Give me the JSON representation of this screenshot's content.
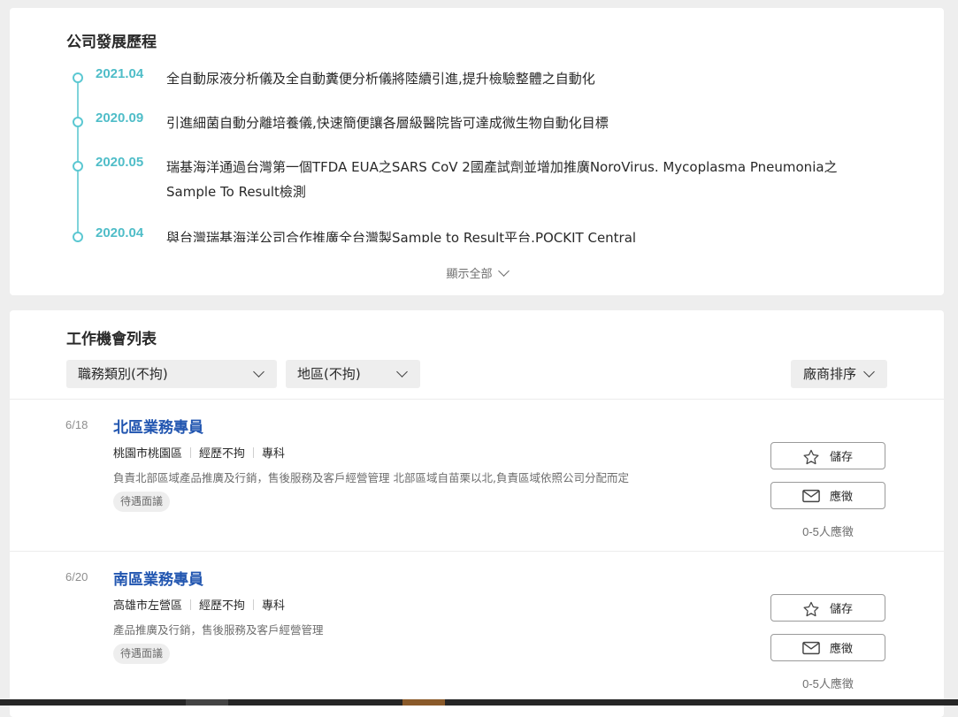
{
  "history": {
    "title": "公司發展歷程",
    "items": [
      {
        "date": "2021.04",
        "text": "全自動尿液分析儀及全自動糞便分析儀將陸續引進,提升檢驗整體之自動化"
      },
      {
        "date": "2020.09",
        "text": "引進細菌自動分離培養儀,快速簡便讓各層級醫院皆可達成微生物自動化目標"
      },
      {
        "date": "2020.05",
        "text": "瑞基海洋通過台灣第一個TFDA EUA之SARS CoV 2國產試劑並增加推廣NoroVirus. Mycoplasma Pneumonia之Sample To Result檢測"
      },
      {
        "date": "2020.04",
        "text": "與台灣瑞基海洋公司合作推廣全台灣製Sample to Result平台.POCKIT Central"
      }
    ],
    "show_all_label": "顯示全部"
  },
  "jobs": {
    "title": "工作機會列表",
    "filters": {
      "category": "職務類別(不拘)",
      "area": "地區(不拘)",
      "sort": "廠商排序"
    },
    "list": [
      {
        "date": "6/18",
        "title": "北區業務專員",
        "location": "桃園市桃園區",
        "experience": "經歷不拘",
        "education": "專科",
        "description": "負責北部區域產品推廣及行銷，售後服務及客戶經營管理 北部區域自苗栗以北,負責區域依照公司分配而定",
        "salary": "待遇面議",
        "save_label": "儲存",
        "apply_label": "應徵",
        "applicants": "0-5人應徵"
      },
      {
        "date": "6/20",
        "title": "南區業務專員",
        "location": "高雄市左營區",
        "experience": "經歷不拘",
        "education": "專科",
        "description": "產品推廣及行銷，售後服務及客戶經營管理",
        "salary": "待遇面議",
        "save_label": "儲存",
        "apply_label": "應徵",
        "applicants": "0-5人應徵"
      }
    ]
  }
}
